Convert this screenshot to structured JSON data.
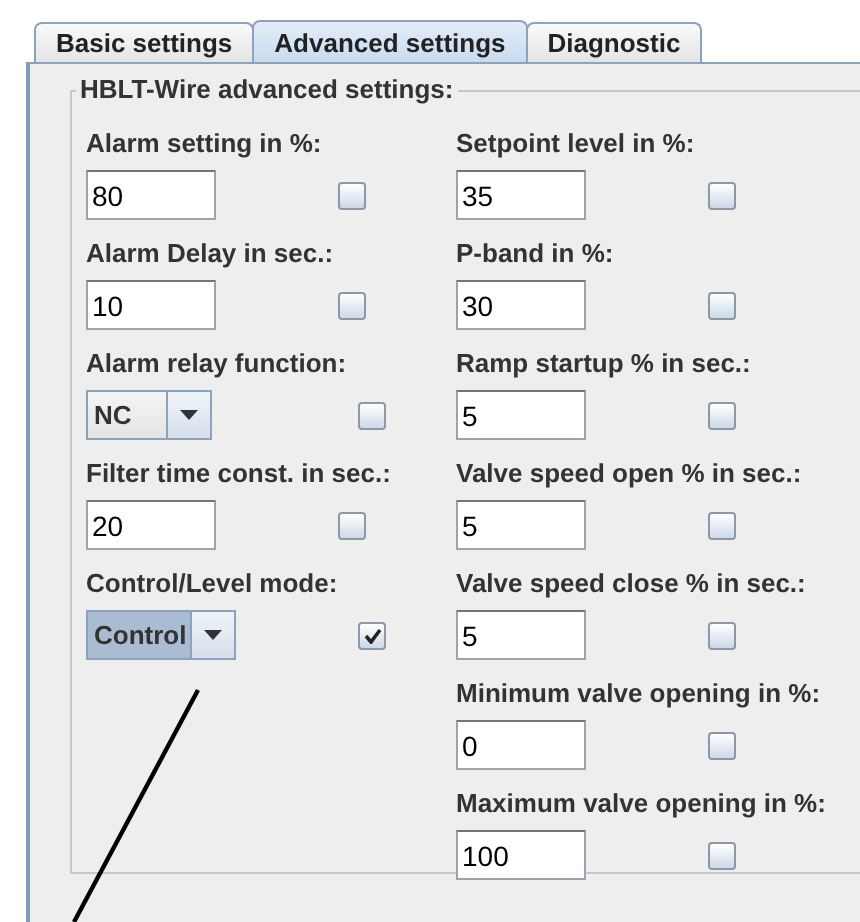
{
  "tabs": [
    {
      "label": "Basic settings",
      "selected": false
    },
    {
      "label": "Advanced settings",
      "selected": true
    },
    {
      "label": "Diagnostic",
      "selected": false
    }
  ],
  "group": {
    "title": "HBLT-Wire advanced settings:"
  },
  "columns": [
    [
      {
        "label": "Alarm setting in %:",
        "kind": "text",
        "value": "80",
        "checked": false
      },
      {
        "label": "Alarm Delay in sec.:",
        "kind": "text",
        "value": "10",
        "checked": false
      },
      {
        "label": "Alarm relay function:",
        "kind": "combo",
        "value": "NC",
        "highlighted": false,
        "checked": false
      },
      {
        "label": "Filter time const. in sec.:",
        "kind": "text",
        "value": "20",
        "checked": false
      },
      {
        "label": "Control/Level mode:",
        "kind": "combo",
        "value": "Control",
        "highlighted": true,
        "checked": true
      }
    ],
    [
      {
        "label": "Setpoint level in %:",
        "kind": "text",
        "value": "35",
        "checked": false
      },
      {
        "label": "P-band in %:",
        "kind": "text",
        "value": "30",
        "checked": false
      },
      {
        "label": "Ramp startup % in sec.:",
        "kind": "text",
        "value": "5",
        "checked": false
      },
      {
        "label": "Valve speed open % in sec.:",
        "kind": "text",
        "value": "5",
        "checked": false
      },
      {
        "label": "Valve speed close % in sec.:",
        "kind": "text",
        "value": "5",
        "checked": false
      },
      {
        "label": "Minimum valve opening in %:",
        "kind": "text",
        "value": "0",
        "checked": false
      },
      {
        "label": "Maximum valve opening in %:",
        "kind": "text",
        "value": "100",
        "checked": false
      }
    ]
  ]
}
